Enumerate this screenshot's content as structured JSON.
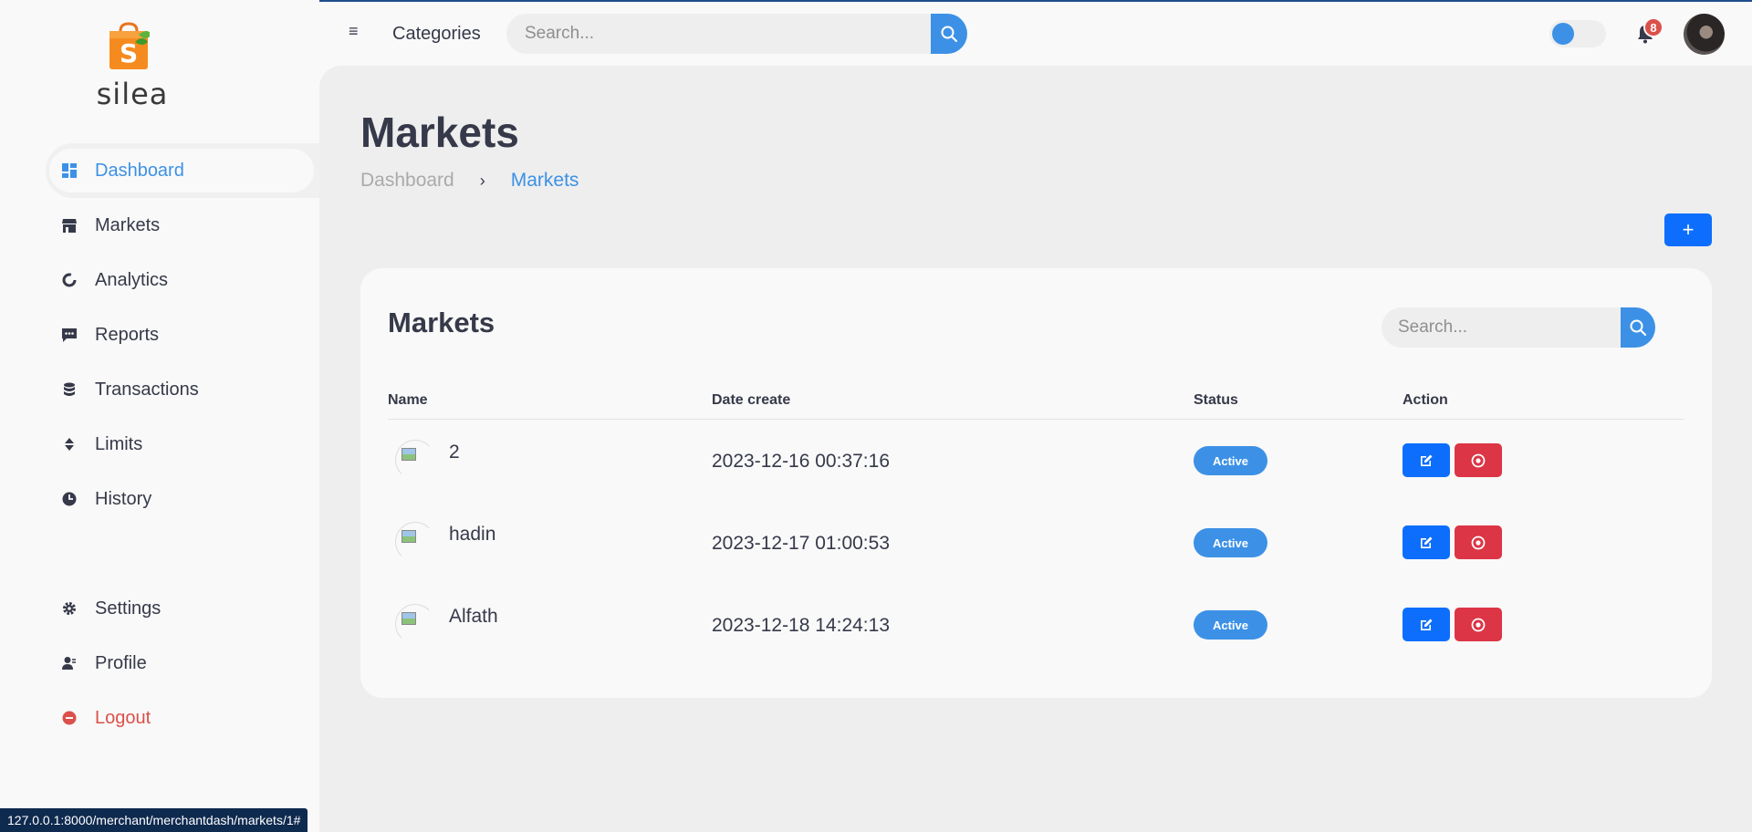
{
  "brand": {
    "name": "silea",
    "logo_letter": "S"
  },
  "sidebar": {
    "items": [
      {
        "label": "Dashboard",
        "icon": "dashboard-icon",
        "active": true
      },
      {
        "label": "Markets",
        "icon": "store-icon"
      },
      {
        "label": "Analytics",
        "icon": "doughnut-chart-icon"
      },
      {
        "label": "Reports",
        "icon": "message-dots-icon"
      },
      {
        "label": "Transactions",
        "icon": "coins-icon"
      },
      {
        "label": "Limits",
        "icon": "sort-icon"
      },
      {
        "label": "History",
        "icon": "clock-icon"
      }
    ],
    "bottom": [
      {
        "label": "Settings",
        "icon": "gear-icon"
      },
      {
        "label": "Profile",
        "icon": "user-icon"
      },
      {
        "label": "Logout",
        "icon": "logout-icon"
      }
    ]
  },
  "nav": {
    "categories_label": "Categories",
    "search_placeholder": "Search...",
    "notification_count": "8"
  },
  "page": {
    "title": "Markets",
    "breadcrumb": [
      "Dashboard",
      "Markets"
    ],
    "add_label": "+"
  },
  "card": {
    "title": "Markets",
    "search_placeholder": "Search...",
    "columns": [
      "Name",
      "Date create",
      "Status",
      "Action"
    ],
    "rows": [
      {
        "name": "2",
        "date": "2023-12-16 00:37:16",
        "status": "Active"
      },
      {
        "name": "hadin",
        "date": "2023-12-17 01:00:53",
        "status": "Active"
      },
      {
        "name": "Alfath",
        "date": "2023-12-18 14:24:13",
        "status": "Active"
      }
    ]
  },
  "statusbar": {
    "url": "127.0.0.1:8000/merchant/merchantdash/markets/1#"
  },
  "colors": {
    "accent": "#3c91e6",
    "primary": "#0d6efd",
    "danger": "#dc3545",
    "logout": "#db504a"
  }
}
